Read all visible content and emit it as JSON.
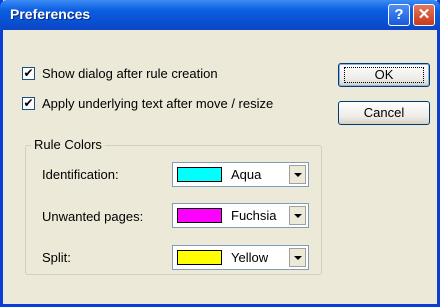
{
  "window": {
    "title": "Preferences",
    "help_glyph": "?",
    "close_glyph": "✕"
  },
  "options": [
    {
      "checked": true,
      "label": "Show dialog after rule creation"
    },
    {
      "checked": true,
      "label": "Apply underlying text after move / resize"
    }
  ],
  "buttons": {
    "ok": "OK",
    "cancel": "Cancel"
  },
  "rule_colors": {
    "title": "Rule Colors",
    "items": [
      {
        "label": "Identification:",
        "value": "Aqua",
        "color": "#00ffff"
      },
      {
        "label": "Unwanted pages:",
        "value": "Fuchsia",
        "color": "#ff00ff"
      },
      {
        "label": "Split:",
        "value": "Yellow",
        "color": "#ffff00"
      }
    ]
  },
  "check_glyph": "✔"
}
